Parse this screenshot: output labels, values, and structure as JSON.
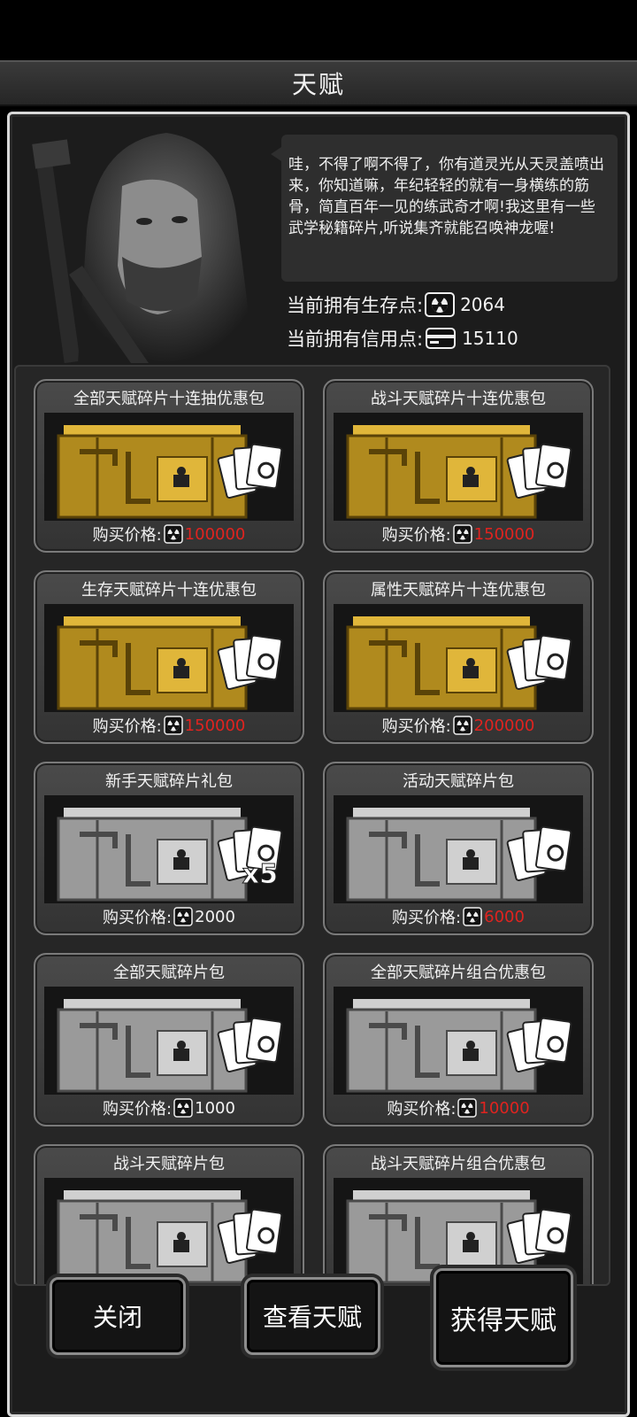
{
  "header": {
    "title": "天赋"
  },
  "npc": {
    "speech": "哇，不得了啊不得了，你有道灵光从天灵盖喷出来，你知道嘛，年纪轻轻的就有一身横练的筋骨，简直百年一见的练武奇才啊!我这里有一些武学秘籍碎片,听说集齐就能召唤神龙喔!"
  },
  "stats": {
    "survival_label": "当前拥有生存点:",
    "survival_value": "2064",
    "credit_label": "当前拥有信用点:",
    "credit_value": "15110"
  },
  "shop": {
    "price_label": "购买价格:",
    "packs": [
      {
        "name": "全部天赋碎片十连抽优惠包",
        "price": "100000",
        "price_color": "#e0231f",
        "chest": "gold",
        "extra": ""
      },
      {
        "name": "战斗天赋碎片十连优惠包",
        "price": "150000",
        "price_color": "#e0231f",
        "chest": "gold",
        "extra": ""
      },
      {
        "name": "生存天赋碎片十连优惠包",
        "price": "150000",
        "price_color": "#e0231f",
        "chest": "gold",
        "extra": ""
      },
      {
        "name": "属性天赋碎片十连优惠包",
        "price": "200000",
        "price_color": "#e0231f",
        "chest": "gold",
        "extra": ""
      },
      {
        "name": "新手天赋碎片礼包",
        "price": "2000",
        "price_color": "#f2f2f2",
        "chest": "silver",
        "extra": "x5"
      },
      {
        "name": "活动天赋碎片包",
        "price": "6000",
        "price_color": "#e0231f",
        "chest": "silver",
        "extra": ""
      },
      {
        "name": "全部天赋碎片包",
        "price": "1000",
        "price_color": "#f2f2f2",
        "chest": "silver",
        "extra": ""
      },
      {
        "name": "全部天赋碎片组合优惠包",
        "price": "10000",
        "price_color": "#e0231f",
        "chest": "silver",
        "extra": ""
      },
      {
        "name": "战斗天赋碎片包",
        "price": "",
        "price_color": "#f2f2f2",
        "chest": "silver",
        "extra": ""
      },
      {
        "name": "战斗天赋碎片组合优惠包",
        "price": "",
        "price_color": "#e0231f",
        "chest": "silver",
        "extra": ""
      }
    ]
  },
  "buttons": {
    "close": "关闭",
    "view": "查看天赋",
    "obtain": "获得天赋"
  },
  "icons": {
    "survival": "radiation-icon",
    "credit": "credit-card-icon"
  }
}
